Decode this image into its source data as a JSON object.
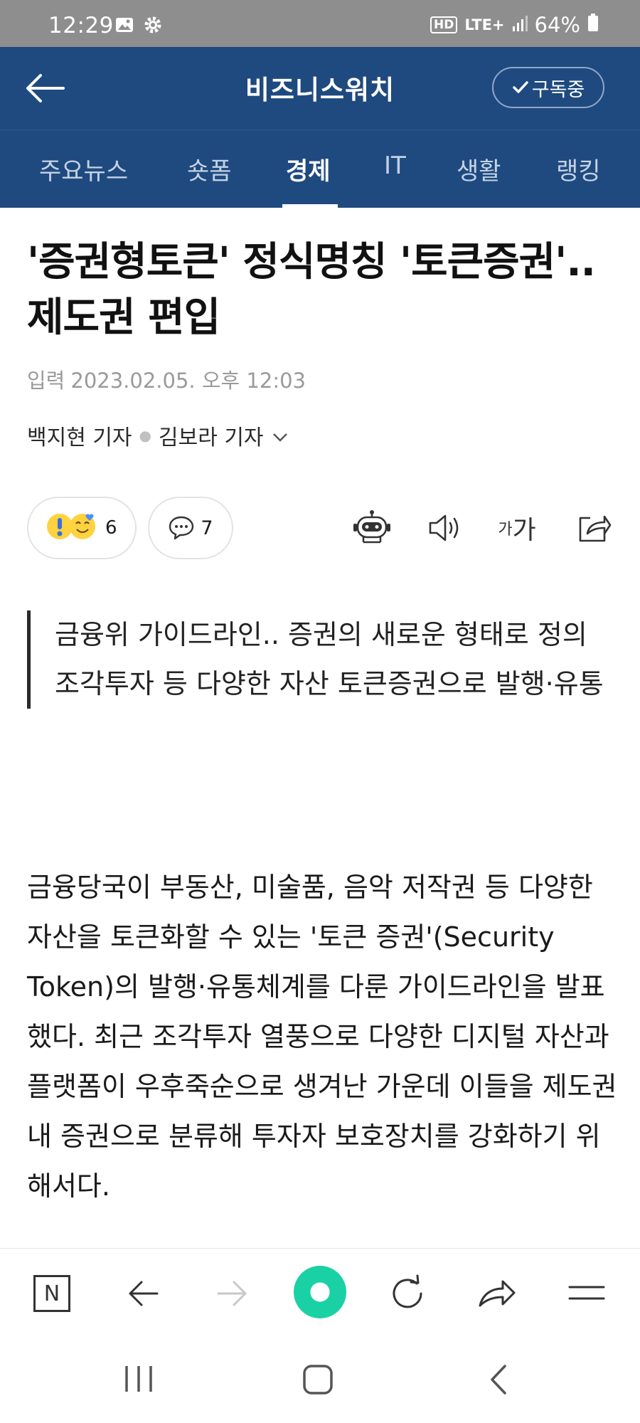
{
  "status_bar": {
    "time": "12:29",
    "network_badge": "HD",
    "network_type": "LTE+",
    "battery": "64%",
    "icons": [
      "image-icon",
      "gear-icon",
      "signal-icon",
      "battery-icon"
    ]
  },
  "header": {
    "title": "비즈니스워치",
    "subscribe_label": "구독중",
    "icons": [
      "back-arrow-icon",
      "check-icon"
    ]
  },
  "tabs": [
    {
      "label": "주요뉴스",
      "active": false
    },
    {
      "label": "숏폼",
      "active": false
    },
    {
      "label": "경제",
      "active": true
    },
    {
      "label": "IT",
      "active": false
    },
    {
      "label": "생활",
      "active": false
    },
    {
      "label": "랭킹",
      "active": false
    }
  ],
  "article": {
    "title": "'증권형토큰' 정식명칭 '토큰증권'.. 제도권 편입",
    "date_label": "입력",
    "date": "2023.02.05. 오후 12:03",
    "reporters": [
      "백지현 기자",
      "김보라 기자"
    ],
    "reaction_count": "6",
    "comment_count": "7",
    "font_size_label_small": "가",
    "font_size_label_large": "가",
    "summary_lines": [
      "금융위 가이드라인.. 증권의 새로운 형태로 정의",
      "조각투자 등 다양한 자산 토큰증권으로 발행·유통"
    ],
    "body": "금융당국이 부동산, 미술품, 음악 저작권 등 다양한 자산을 토큰화할 수 있는 '토큰 증권'(Security Token)의 발행·유통체계를 다룬 가이드라인을 발표했다. 최근 조각투자 열풍으로 다양한 디지털 자산과 플랫폼이 우후죽순으로 생겨난 가운데 이들을 제도권 내 증권으로 분류해 투자자 보호장치를 강화하기 위해서다."
  },
  "browser_bar": {
    "home_label": "N",
    "icons": [
      "naver-home-icon",
      "back-arrow-icon",
      "forward-arrow-icon",
      "green-dot-icon",
      "refresh-icon",
      "share-arrow-icon",
      "menu-icon"
    ],
    "accent_color": "#1ad1a5"
  },
  "colors": {
    "header_bg": "#1f4a80",
    "status_bar_bg": "#8e8e8e"
  }
}
